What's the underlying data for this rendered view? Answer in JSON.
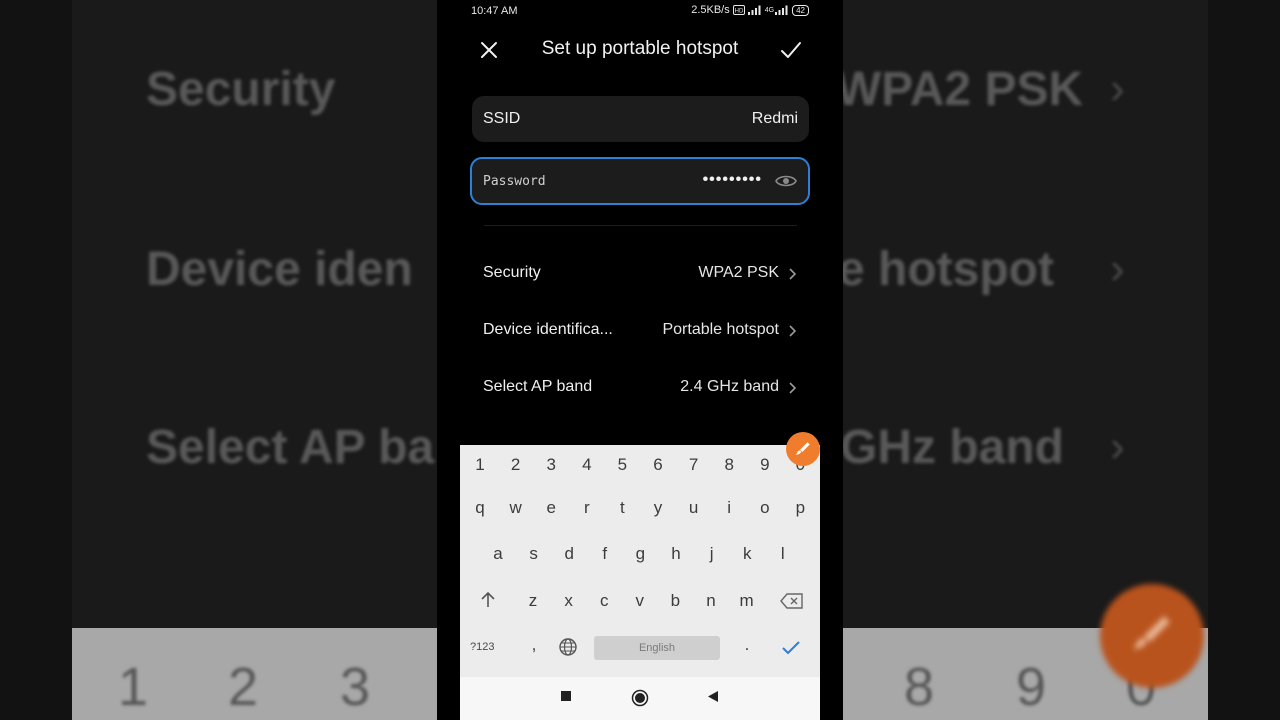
{
  "status_bar": {
    "time": "10:47 AM",
    "speed": "2.5KB/s",
    "network": "4G",
    "battery": "42"
  },
  "header": {
    "title": "Set up portable hotspot"
  },
  "ssid": {
    "label": "SSID",
    "value": "Redmi"
  },
  "password": {
    "label": "Password",
    "value": "•••••••••"
  },
  "settings": [
    {
      "label": "Security",
      "value": "WPA2 PSK"
    },
    {
      "label": "Device identifica...",
      "value": "Portable hotspot"
    },
    {
      "label": "Select AP band",
      "value": "2.4 GHz band"
    }
  ],
  "keyboard": {
    "number_row": [
      "1",
      "2",
      "3",
      "4",
      "5",
      "6",
      "7",
      "8",
      "9",
      "0"
    ],
    "row1": [
      "q",
      "w",
      "e",
      "r",
      "t",
      "y",
      "u",
      "i",
      "o",
      "p"
    ],
    "row2": [
      "a",
      "s",
      "d",
      "f",
      "g",
      "h",
      "j",
      "k",
      "l"
    ],
    "row3": [
      "z",
      "x",
      "c",
      "v",
      "b",
      "n",
      "m"
    ],
    "symbols_key": "?123",
    "comma_key": ",",
    "period_key": ".",
    "space_label": "English"
  },
  "background": {
    "row1_label": "Security",
    "row1_value": "WPA2 PSK",
    "row2_label": "Device iden",
    "row2_value": "e hotspot",
    "row3_label": "Select AP ba",
    "row3_value": "GHz band",
    "numbers_left": [
      "1",
      "2",
      "3"
    ],
    "numbers_right": [
      "8",
      "9",
      "0"
    ]
  },
  "colors": {
    "accent": "#2e7fd6",
    "fab": "#f07d2d",
    "screen_bg": "#000000",
    "keyboard_bg": "#ececec"
  }
}
